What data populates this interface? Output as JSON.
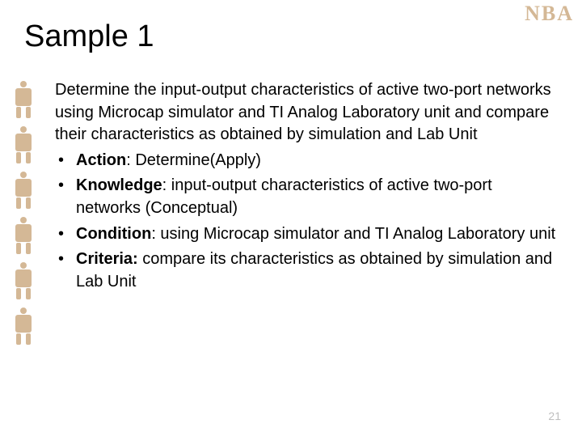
{
  "logo": "NBA",
  "title": "Sample 1",
  "intro": "Determine the input-output characteristics of active two-port networks using Microcap simulator and TI Analog Laboratory unit and compare their characteristics as obtained by simulation and Lab Unit",
  "bullets": [
    {
      "label": "Action",
      "text": ": Determine(Apply)"
    },
    {
      "label": "Knowledge",
      "text": ": input-output characteristics of active two-port networks (Conceptual)"
    },
    {
      "label": "Condition",
      "text": ": using Microcap simulator and TI Analog Laboratory unit"
    },
    {
      "label": "Criteria:",
      "text": " compare its characteristics as obtained by simulation and Lab Unit"
    }
  ],
  "page_number": "21"
}
